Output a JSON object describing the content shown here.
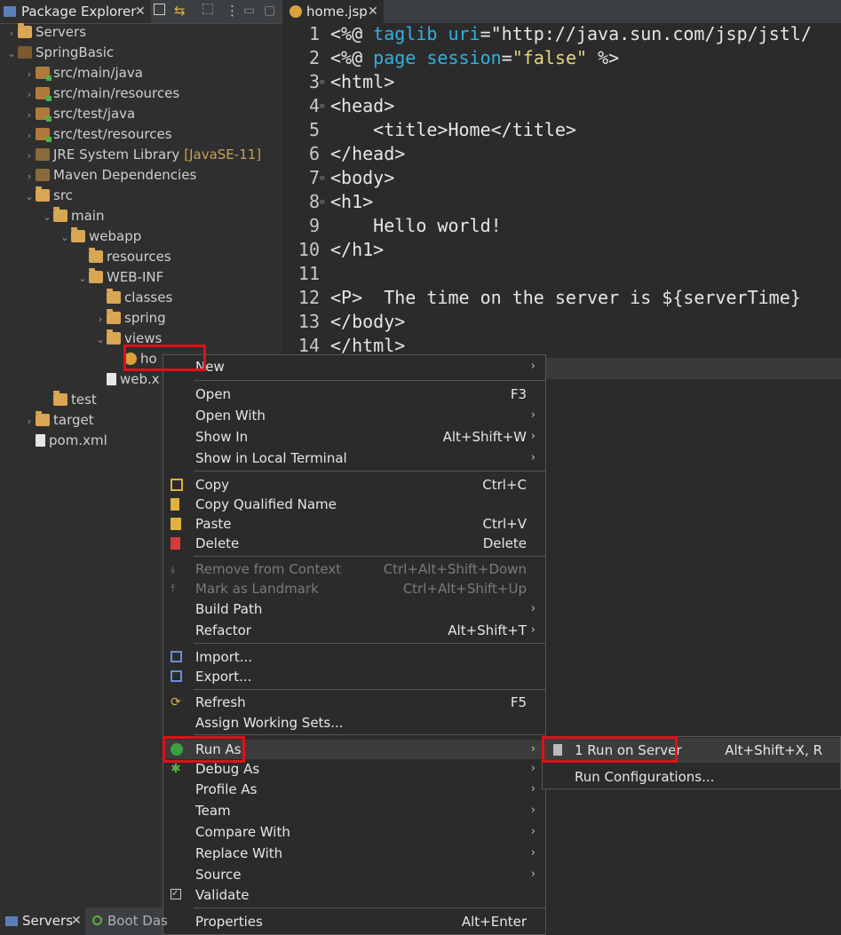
{
  "explorer": {
    "title": "Package Explorer",
    "tree": [
      {
        "label": "Servers",
        "indent": 0,
        "arrow": "›",
        "icon": "folder"
      },
      {
        "label": "SpringBasic",
        "indent": 0,
        "arrow": "⌄",
        "icon": "project"
      },
      {
        "label": "src/main/java",
        "indent": 1,
        "arrow": "›",
        "icon": "package-folder"
      },
      {
        "label": "src/main/resources",
        "indent": 1,
        "arrow": "›",
        "icon": "package-folder"
      },
      {
        "label": "src/test/java",
        "indent": 1,
        "arrow": "›",
        "icon": "package-folder"
      },
      {
        "label": "src/test/resources",
        "indent": 1,
        "arrow": "›",
        "icon": "package-folder"
      },
      {
        "label": "JRE System Library",
        "tag": "[JavaSE-11]",
        "indent": 1,
        "arrow": "›",
        "icon": "library"
      },
      {
        "label": "Maven Dependencies",
        "indent": 1,
        "arrow": "›",
        "icon": "library"
      },
      {
        "label": "src",
        "indent": 1,
        "arrow": "⌄",
        "icon": "folder"
      },
      {
        "label": "main",
        "indent": 2,
        "arrow": "⌄",
        "icon": "folder"
      },
      {
        "label": "webapp",
        "indent": 3,
        "arrow": "⌄",
        "icon": "folder"
      },
      {
        "label": "resources",
        "indent": 4,
        "arrow": "",
        "icon": "folder"
      },
      {
        "label": "WEB-INF",
        "indent": 4,
        "arrow": "⌄",
        "icon": "folder"
      },
      {
        "label": "classes",
        "indent": 5,
        "arrow": "",
        "icon": "folder"
      },
      {
        "label": "spring",
        "indent": 5,
        "arrow": "›",
        "icon": "folder"
      },
      {
        "label": "views",
        "indent": 5,
        "arrow": "⌄",
        "icon": "folder"
      },
      {
        "label": "ho",
        "indent": 6,
        "arrow": "",
        "icon": "jsp-file"
      },
      {
        "label": "web.x",
        "indent": 5,
        "arrow": "",
        "icon": "xml-file"
      },
      {
        "label": "test",
        "indent": 2,
        "arrow": "",
        "icon": "folder"
      },
      {
        "label": "target",
        "indent": 1,
        "arrow": "›",
        "icon": "folder"
      },
      {
        "label": "pom.xml",
        "indent": 1,
        "arrow": "",
        "icon": "xml-file"
      }
    ]
  },
  "editor": {
    "tab_label": "home.jsp",
    "lines": [
      {
        "n": "1",
        "fold": false,
        "code": "<%@ taglib uri=\"http://java.sun.com/jsp/jstl/"
      },
      {
        "n": "2",
        "fold": false,
        "code": "<%@ page session=\"false\" %>"
      },
      {
        "n": "3",
        "fold": true,
        "code": "<html>"
      },
      {
        "n": "4",
        "fold": true,
        "code": "<head>"
      },
      {
        "n": "5",
        "fold": false,
        "code": "    <title>Home</title>"
      },
      {
        "n": "6",
        "fold": false,
        "code": "</head>"
      },
      {
        "n": "7",
        "fold": true,
        "code": "<body>"
      },
      {
        "n": "8",
        "fold": true,
        "code": "<h1>"
      },
      {
        "n": "9",
        "fold": false,
        "code": "    Hello world!"
      },
      {
        "n": "10",
        "fold": false,
        "code": "</h1>"
      },
      {
        "n": "11",
        "fold": false,
        "code": ""
      },
      {
        "n": "12",
        "fold": false,
        "code": "<P>  The time on the server is ${serverTime}"
      },
      {
        "n": "13",
        "fold": false,
        "code": "</body>"
      },
      {
        "n": "14",
        "fold": false,
        "code": "</html>"
      }
    ]
  },
  "context_menu": {
    "new": "New",
    "open": "Open",
    "open_acc": "F3",
    "open_with": "Open With",
    "show_in": "Show In",
    "show_in_acc": "Alt+Shift+W",
    "show_terminal": "Show in Local Terminal",
    "copy": "Copy",
    "copy_acc": "Ctrl+C",
    "copy_qualified": "Copy Qualified Name",
    "paste": "Paste",
    "paste_acc": "Ctrl+V",
    "delete": "Delete",
    "delete_acc": "Delete",
    "remove_context": "Remove from Context",
    "remove_context_acc": "Ctrl+Alt+Shift+Down",
    "mark_landmark": "Mark as Landmark",
    "mark_landmark_acc": "Ctrl+Alt+Shift+Up",
    "build_path": "Build Path",
    "refactor": "Refactor",
    "refactor_acc": "Alt+Shift+T",
    "import": "Import...",
    "export": "Export...",
    "refresh": "Refresh",
    "refresh_acc": "F5",
    "assign_sets": "Assign Working Sets...",
    "run_as": "Run As",
    "debug_as": "Debug As",
    "profile_as": "Profile As",
    "team": "Team",
    "compare_with": "Compare With",
    "replace_with": "Replace With",
    "source": "Source",
    "validate": "Validate",
    "properties": "Properties",
    "properties_acc": "Alt+Enter"
  },
  "submenu": {
    "run_on_server": "1 Run on Server",
    "run_on_server_acc": "Alt+Shift+X, R",
    "run_configs": "Run Configurations..."
  },
  "bottom": {
    "servers_tab": "Servers",
    "boot_tab": "Boot Das"
  },
  "colors": {
    "highlight_box": "#e0101a",
    "keyword": "#2fb2e0",
    "string": "#e6d87c"
  }
}
